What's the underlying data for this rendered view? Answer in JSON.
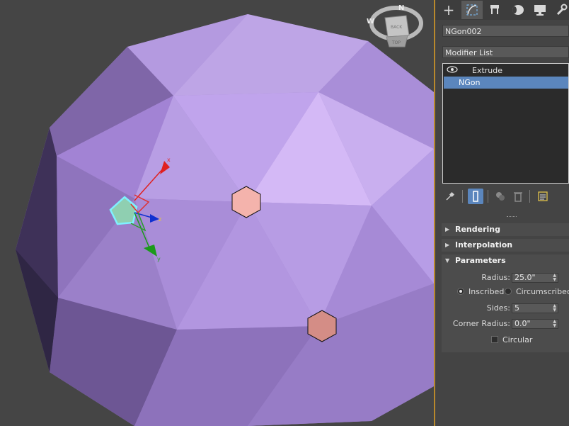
{
  "viewport": {
    "compass_letters": {
      "n": "N",
      "w": "W"
    },
    "viewcube_labels": {
      "side": "BACK",
      "top": "TOP"
    },
    "gizmo_axes": {
      "x": "x",
      "y": "y",
      "z": "z"
    }
  },
  "panel": {
    "tabs": [
      {
        "icon": "create-plus-icon"
      },
      {
        "icon": "modify-icon",
        "active": true
      },
      {
        "icon": "hierarchy-icon"
      },
      {
        "icon": "motion-icon"
      },
      {
        "icon": "display-icon"
      },
      {
        "icon": "utilities-wrench-icon"
      }
    ],
    "object_name": "NGon002",
    "modifier_list": "Modifier List",
    "stack": [
      {
        "label": "Extrude",
        "has_eye": true
      },
      {
        "label": "NGon",
        "selected": true
      }
    ],
    "rollouts": {
      "rendering": "Rendering",
      "interpolation": "Interpolation",
      "parameters": "Parameters"
    },
    "params": {
      "radius_label": "Radius:",
      "radius_value": "25.0\"",
      "inscribed_label": "Inscribed",
      "circumscribed_label": "Circumscribed",
      "sides_label": "Sides:",
      "sides_value": "5",
      "corner_radius_label": "Corner Radius:",
      "corner_radius_value": "0.0\"",
      "circular_label": "Circular"
    },
    "colors": {
      "accent": "#5b86bd",
      "divider": "#b9892c",
      "sphere": "#a88ad6"
    }
  }
}
